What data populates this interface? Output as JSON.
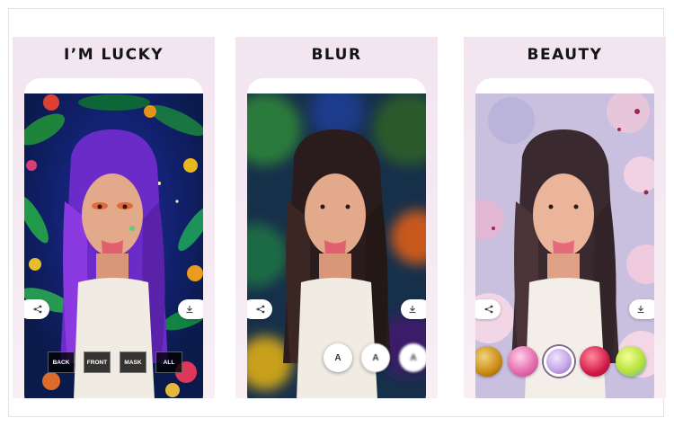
{
  "panels": [
    {
      "title": "I’M LUCKY",
      "modes": [
        "BACK",
        "FRONT",
        "MASK",
        "ALL"
      ]
    },
    {
      "title": "BLUR",
      "blur_buttons": [
        "A",
        "A",
        "A"
      ]
    },
    {
      "title": "BEAUTY",
      "filter_colors": [
        "#c98a14",
        "#e66fb0",
        "#c7a6e6",
        "#d4194a",
        "#b7e23a"
      ]
    }
  ],
  "icons": {
    "share": "share-icon",
    "download": "download-icon"
  },
  "colors": {
    "panel_bg": "#f2e5f0",
    "mode_button_bg": "#141414",
    "accent_purple": "#5a2a9c",
    "hair_purple": "#6b2bc8"
  }
}
